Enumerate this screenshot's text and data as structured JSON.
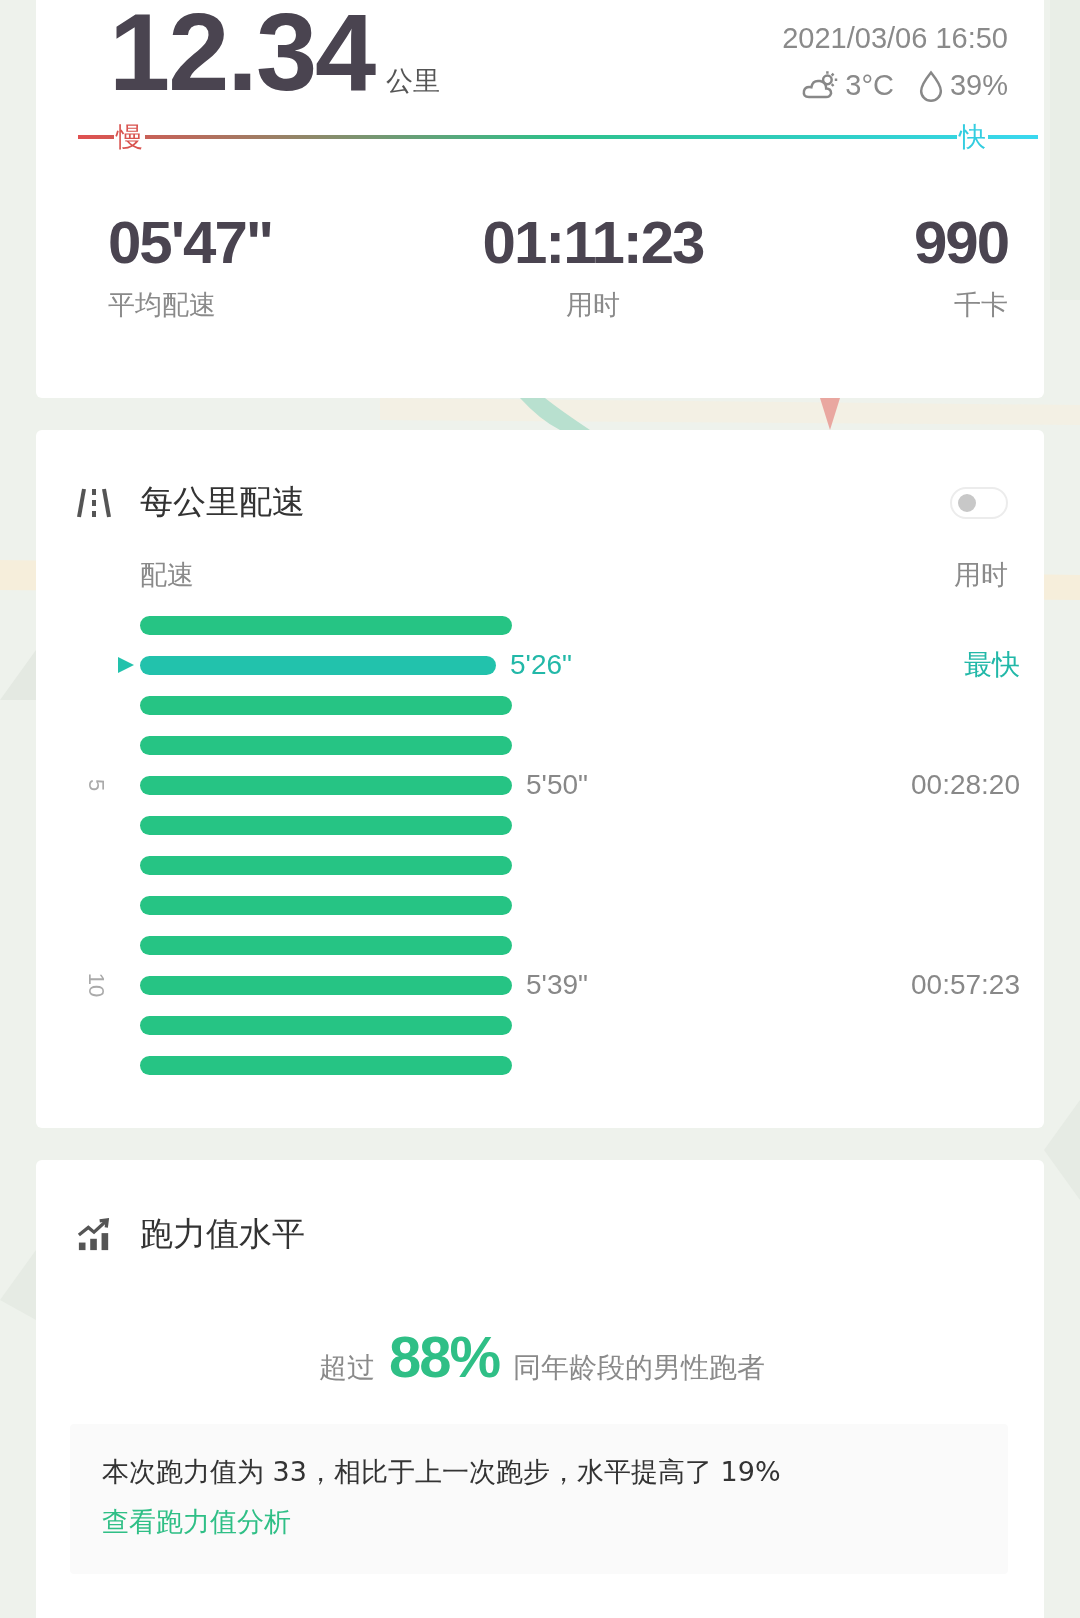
{
  "summary": {
    "distance": "12.34",
    "distance_unit": "公里",
    "datetime": "2021/03/06 16:50",
    "temperature": "3°C",
    "humidity": "39%",
    "slow_label": "慢",
    "fast_label": "快",
    "stats": [
      {
        "value": "05'47\"",
        "label": "平均配速"
      },
      {
        "value": "01:11:23",
        "label": "用时"
      },
      {
        "value": "990",
        "label": "千卡"
      }
    ]
  },
  "splits": {
    "title": "每公里配速",
    "toggle": {
      "on": false
    },
    "pace_header": "配速",
    "time_header": "用时",
    "rows": [
      {
        "fastest": false
      },
      {
        "fastest": true,
        "pace": "5'26\"",
        "note": "最快"
      },
      {
        "fastest": false
      },
      {
        "fastest": false
      },
      {
        "fastest": false,
        "axis": "5",
        "pace": "5'50\"",
        "note": "00:28:20"
      },
      {
        "fastest": false
      },
      {
        "fastest": false
      },
      {
        "fastest": false
      },
      {
        "fastest": false
      },
      {
        "fastest": false,
        "axis": "10",
        "pace": "5'39\"",
        "note": "00:57:23"
      },
      {
        "fastest": false
      },
      {
        "fastest": false
      }
    ]
  },
  "running_power": {
    "title": "跑力值水平",
    "prefix": "超过",
    "percent": "88%",
    "suffix": "同年龄段的男性跑者",
    "detail": "本次跑力值为 33，相比于上一次跑步，水平提高了 19%",
    "link": "查看跑力值分析"
  }
}
